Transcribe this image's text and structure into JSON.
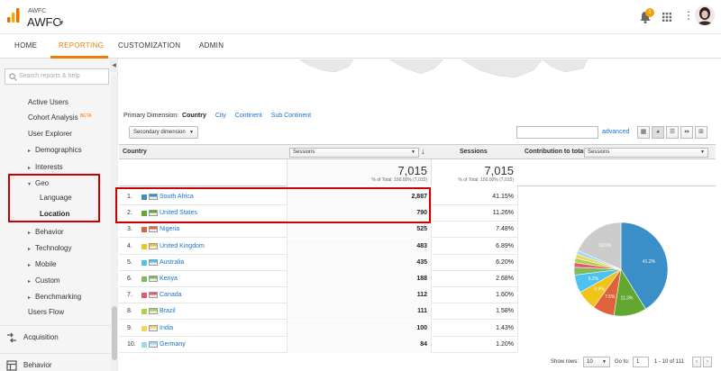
{
  "header": {
    "account_small": "AWFC",
    "account_big": "AWFC",
    "notification_count": "1",
    "colors": {
      "accent": "#f57c00",
      "badge": "#f4a300",
      "link": "#1a73c9",
      "highlight": "#cc0000"
    }
  },
  "nav": {
    "tabs": [
      {
        "label": "HOME"
      },
      {
        "label": "REPORTING",
        "active": true
      },
      {
        "label": "CUSTOMIZATION"
      },
      {
        "label": "ADMIN"
      }
    ]
  },
  "sidebar": {
    "search_placeholder": "Search reports & help",
    "items": [
      {
        "label": "Active Users"
      },
      {
        "label": "Cohort Analysis",
        "badge": "BETA"
      },
      {
        "label": "User Explorer"
      },
      {
        "label": "Demographics"
      },
      {
        "label": "Interests"
      },
      {
        "label": "Geo"
      },
      {
        "label": "Language"
      },
      {
        "label": "Location"
      },
      {
        "label": "Behavior"
      },
      {
        "label": "Technology"
      },
      {
        "label": "Mobile"
      },
      {
        "label": "Custom"
      },
      {
        "label": "Benchmarking"
      },
      {
        "label": "Users Flow"
      }
    ],
    "sections": [
      {
        "label": "Acquisition",
        "icon": "acquisition-icon"
      },
      {
        "label": "Behavior",
        "icon": "behavior-icon"
      }
    ]
  },
  "toolbar": {
    "primary_dimension_label": "Primary Dimension:",
    "primary_dimension_value": "Country",
    "dimension_links": [
      "City",
      "Continent",
      "Sub Continent"
    ],
    "secondary_dimension": "Secondary dimension",
    "advanced": "advanced"
  },
  "table": {
    "headers": {
      "country": "Country",
      "sessions_select": "Sessions",
      "sessions": "Sessions",
      "contribution_label": "Contribution to total:",
      "contribution_select": "Sessions"
    },
    "totals": {
      "value1": "7,015",
      "sub1": "% of Total: 100.00% (7,015)",
      "value2": "7,015",
      "sub2": "% of Total: 100.00% (7,015)"
    },
    "rows": [
      {
        "num": "1.",
        "country": "South Africa",
        "sessions": "2,887",
        "pct": "41.15%",
        "color": "#3a8fc9"
      },
      {
        "num": "2.",
        "country": "United States",
        "sessions": "790",
        "pct": "11.26%",
        "color": "#62a830"
      },
      {
        "num": "3.",
        "country": "Nigeria",
        "sessions": "525",
        "pct": "7.48%",
        "color": "#e0623a"
      },
      {
        "num": "4.",
        "country": "United Kingdom",
        "sessions": "483",
        "pct": "6.89%",
        "color": "#f0c419"
      },
      {
        "num": "5.",
        "country": "Australia",
        "sessions": "435",
        "pct": "6.20%",
        "color": "#4cc3f0"
      },
      {
        "num": "6.",
        "country": "Kenya",
        "sessions": "188",
        "pct": "2.68%",
        "color": "#7dba5b"
      },
      {
        "num": "7.",
        "country": "Canada",
        "sessions": "112",
        "pct": "1.60%",
        "color": "#e85a6a"
      },
      {
        "num": "8.",
        "country": "Brazil",
        "sessions": "111",
        "pct": "1.58%",
        "color": "#a6d34a"
      },
      {
        "num": "9.",
        "country": "India",
        "sessions": "100",
        "pct": "1.43%",
        "color": "#f4d35e"
      },
      {
        "num": "10.",
        "country": "Germany",
        "sessions": "84",
        "pct": "1.20%",
        "color": "#9ad9f5"
      }
    ]
  },
  "chart_data": {
    "type": "pie",
    "categories": [
      "South Africa",
      "United States",
      "Nigeria",
      "United Kingdom",
      "Australia",
      "Kenya",
      "Canada",
      "Brazil",
      "India",
      "Germany",
      "Other"
    ],
    "values": [
      41.15,
      11.26,
      7.48,
      6.89,
      6.2,
      2.68,
      1.6,
      1.58,
      1.43,
      1.2,
      18.5
    ],
    "colors": [
      "#3a8fc9",
      "#62a830",
      "#e0623a",
      "#f0c419",
      "#4cc3f0",
      "#7dba5b",
      "#e85a6a",
      "#a6d34a",
      "#f4d35e",
      "#9ad9f5",
      "#cccccc"
    ],
    "slice_labels": [
      "41.2%",
      "11.3%",
      "7.5%",
      "6.9%",
      "6.2%",
      "",
      "",
      "",
      "",
      "",
      "18.5%"
    ]
  },
  "footer": {
    "show_rows_label": "Show rows:",
    "show_rows_value": "10",
    "goto_label": "Go to:",
    "goto_value": "1",
    "range": "1 - 10 of 111"
  }
}
